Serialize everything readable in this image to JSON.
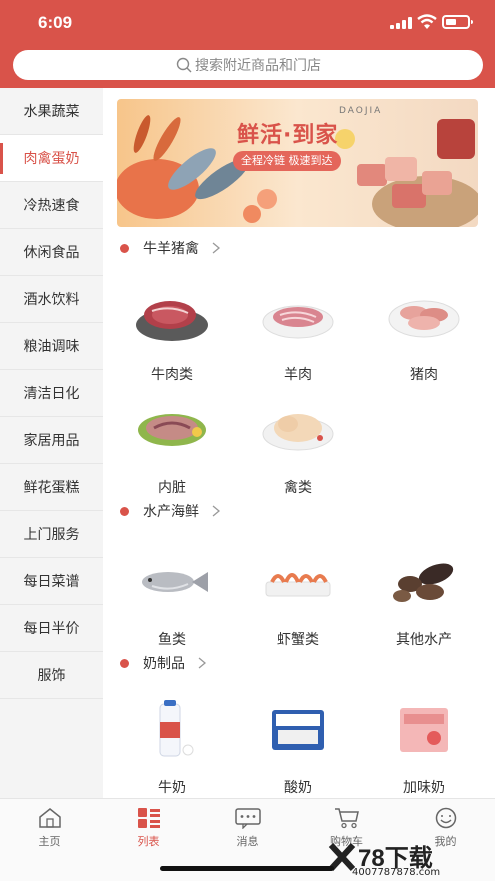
{
  "status_bar": {
    "time": "6:09"
  },
  "search": {
    "placeholder": "搜索附近商品和门店"
  },
  "sidebar": {
    "items": [
      {
        "label": "水果蔬菜"
      },
      {
        "label": "肉禽蛋奶",
        "active": true
      },
      {
        "label": "冷热速食"
      },
      {
        "label": "休闲食品"
      },
      {
        "label": "酒水饮料"
      },
      {
        "label": "粮油调味"
      },
      {
        "label": "清洁日化"
      },
      {
        "label": "家居用品"
      },
      {
        "label": "鲜花蛋糕"
      },
      {
        "label": "上门服务"
      },
      {
        "label": "每日菜谱"
      },
      {
        "label": "每日半价"
      },
      {
        "label": "服饰"
      }
    ]
  },
  "banner": {
    "title": "鲜活·到家",
    "brand": "DAOJIA",
    "slogan": "全程冷链 极速到达"
  },
  "sections": [
    {
      "title": "牛羊猪禽",
      "products": [
        {
          "label": "牛肉类",
          "icon": "beef-icon"
        },
        {
          "label": "羊肉",
          "icon": "lamb-icon"
        },
        {
          "label": "猪肉",
          "icon": "pork-icon"
        },
        {
          "label": "内脏",
          "icon": "offal-icon"
        },
        {
          "label": "禽类",
          "icon": "poultry-icon"
        }
      ]
    },
    {
      "title": "水产海鲜",
      "products": [
        {
          "label": "鱼类",
          "icon": "fish-icon"
        },
        {
          "label": "虾蟹类",
          "icon": "shrimp-icon"
        },
        {
          "label": "其他水产",
          "icon": "sea-cucumber-icon"
        }
      ]
    },
    {
      "title": "奶制品",
      "products": [
        {
          "label": "牛奶",
          "icon": "milk-icon"
        },
        {
          "label": "酸奶",
          "icon": "yogurt-icon"
        },
        {
          "label": "加味奶",
          "icon": "flavored-milk-icon"
        }
      ]
    }
  ],
  "tabbar": {
    "tabs": [
      {
        "label": "主页",
        "icon": "home-icon"
      },
      {
        "label": "列表",
        "icon": "list-icon",
        "active": true
      },
      {
        "label": "消息",
        "icon": "message-icon"
      },
      {
        "label": "购物车",
        "icon": "cart-icon"
      },
      {
        "label": "我的",
        "icon": "profile-icon"
      }
    ]
  },
  "watermark": {
    "brand": "78下载",
    "url": "4007787878.com"
  },
  "colors": {
    "accent": "#d9534a",
    "sidebar_bg": "#f4f4f4",
    "text": "#333333"
  }
}
